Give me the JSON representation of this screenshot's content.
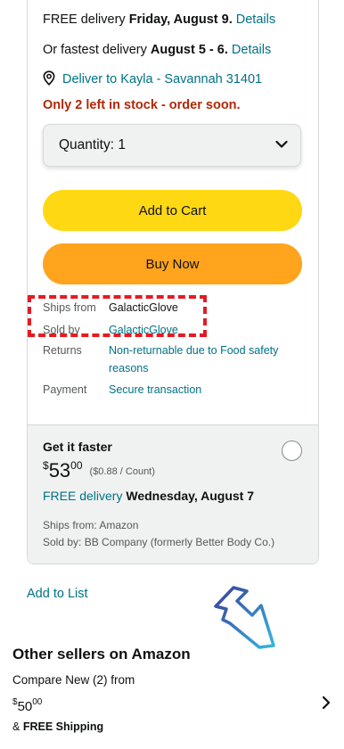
{
  "delivery": {
    "free_prefix": "FREE delivery ",
    "free_date": "Friday, August 9",
    "free_dot": ". ",
    "details1": "Details",
    "fast_prefix": "Or fastest delivery ",
    "fast_date": "August 5 - 6",
    "fast_dot": ". ",
    "details2": "Details",
    "deliver_to": "Deliver to Kayla - Savannah 31401",
    "stock": "Only 2 left in stock - order soon."
  },
  "quantity": {
    "label": "Quantity: 1"
  },
  "buttons": {
    "add_to_cart": "Add to Cart",
    "buy_now": "Buy Now"
  },
  "info": {
    "ships_from_label": "Ships from",
    "ships_from_value": "GalacticGlove",
    "sold_by_label": "Sold by",
    "sold_by_value": "GalacticGlove",
    "returns_label": "Returns",
    "returns_value_1": "Non-returnable due to Food safety",
    "returns_value_2": "reasons",
    "payment_label": "Payment",
    "payment_value": "Secure transaction"
  },
  "faster": {
    "title": "Get it faster",
    "currency": "$",
    "whole": "53",
    "fraction": "00",
    "unit_price": "($0.88 / Count)",
    "free_delivery": "FREE delivery",
    "delivery_date": " Wednesday, August 7",
    "ships_from": "Ships from: Amazon",
    "sold_by": "Sold by: BB Company (formerly Better Body Co.)"
  },
  "add_to_list": "Add to List",
  "others": {
    "title": "Other sellers on Amazon",
    "compare": "Compare New (2) from",
    "currency": "$",
    "whole": "50",
    "fraction": "00",
    "shipping_prefix": "& ",
    "shipping": "FREE Shipping"
  },
  "colors": {
    "link": "#007185",
    "add_to_cart": "#ffd814",
    "buy_now": "#ffa41c",
    "stock_red": "#b12704",
    "highlight_dash": "#e31b23"
  }
}
